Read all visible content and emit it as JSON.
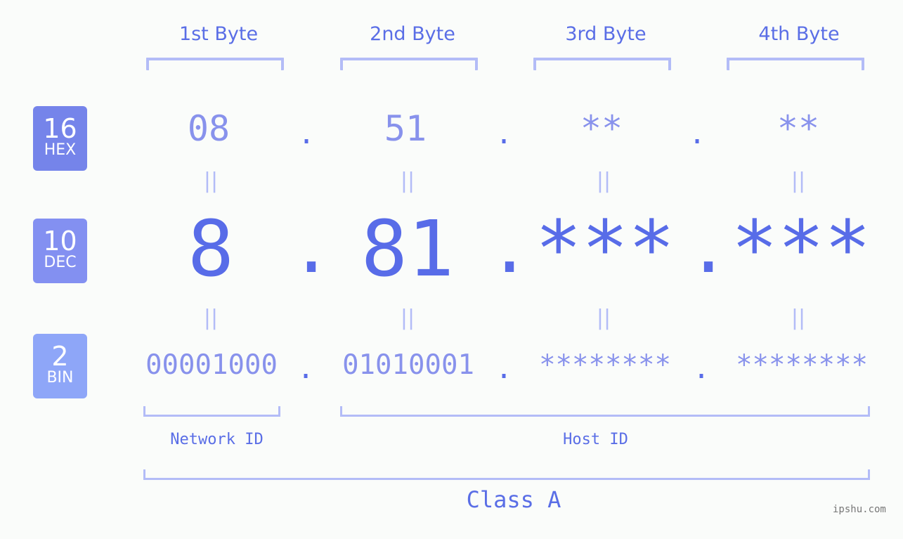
{
  "byte_headers": [
    "1st Byte",
    "2nd Byte",
    "3rd Byte",
    "4th Byte"
  ],
  "bases": {
    "hex": {
      "number": "16",
      "label": "HEX",
      "color": "#7584ea"
    },
    "dec": {
      "number": "10",
      "label": "DEC",
      "color": "#8390f1"
    },
    "bin": {
      "number": "2",
      "label": "BIN",
      "color": "#8ea6f8"
    }
  },
  "hex_values": [
    "08",
    "51",
    "**",
    "**"
  ],
  "dec_values": [
    "8",
    "81",
    "***",
    "***"
  ],
  "bin_values": [
    "00001000",
    "01010001",
    "********",
    "********"
  ],
  "separator": ".",
  "equals_sign": "||",
  "network_id_label": "Network ID",
  "host_id_label": "Host ID",
  "class_label": "Class A",
  "watermark": "ipshu.com",
  "colors": {
    "accent": "#586ce8",
    "header_text": "#5a6ee6",
    "bracket": "#b3bcf7",
    "light_value": "#8892ec",
    "background": "#fafcfa"
  }
}
